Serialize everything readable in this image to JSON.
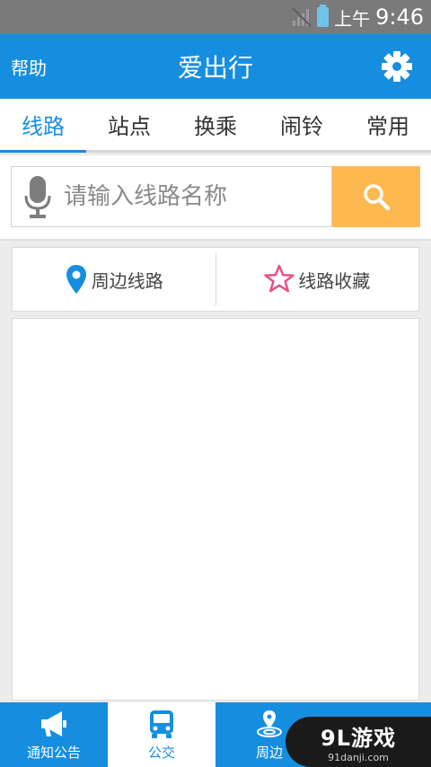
{
  "status": {
    "ampm": "上午",
    "time": "9:46"
  },
  "appbar": {
    "help": "帮助",
    "title": "爱出行"
  },
  "tabs": [
    "线路",
    "站点",
    "换乘",
    "闹铃",
    "常用"
  ],
  "search": {
    "placeholder": "请输入线路名称",
    "value": ""
  },
  "quick": {
    "nearby": "周边线路",
    "favorites": "线路收藏"
  },
  "bottom_nav": [
    {
      "label": "通知公告",
      "icon": "megaphone-icon"
    },
    {
      "label": "公交",
      "icon": "bus-icon"
    },
    {
      "label": "周边",
      "icon": "location-icon"
    }
  ],
  "watermark": {
    "main": "9L游戏",
    "sub": "91danji.com"
  },
  "colors": {
    "primary": "#168ee0",
    "search_button": "#fdb94f",
    "favorite": "#e8508a",
    "statusbar": "#7a7a7a"
  }
}
